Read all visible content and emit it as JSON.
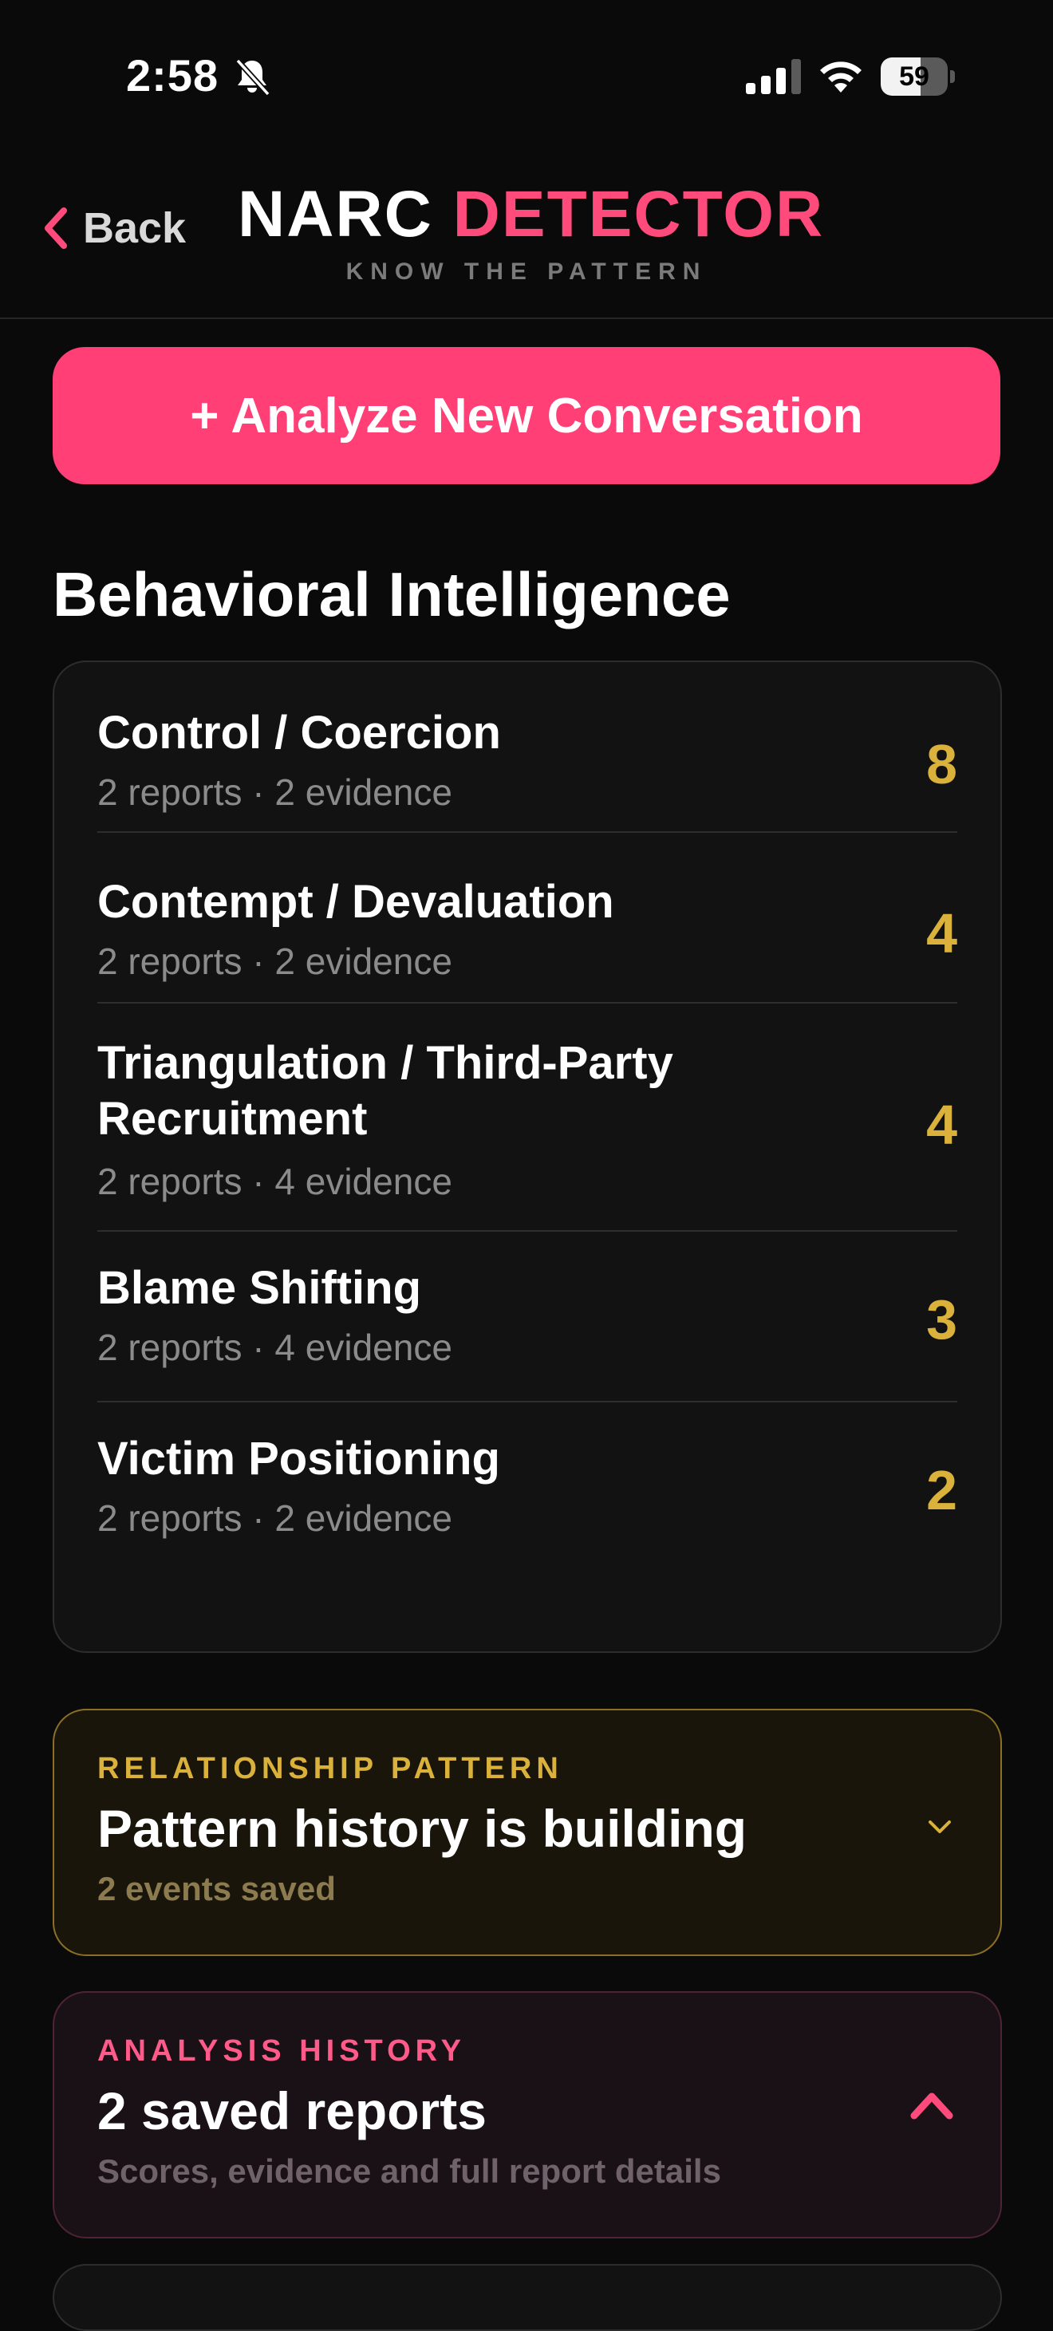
{
  "status_bar": {
    "time": "2:58",
    "battery": "59",
    "battery_level": 0.59
  },
  "nav": {
    "back_label": "Back",
    "title_part1": "NARC",
    "title_part2": "DETECTOR",
    "subtitle": "KNOW THE PATTERN"
  },
  "analyze_button": "+ Analyze New Conversation",
  "behavioral_title": "Behavioral Intelligence",
  "behaviors": [
    {
      "label": "Control / Coercion",
      "meta": "2 reports · 2 evidence",
      "score": "8"
    },
    {
      "label": "Contempt / Devaluation",
      "meta": "2 reports · 2 evidence",
      "score": "4"
    },
    {
      "label": "Triangulation / Third-Party Recruitment",
      "meta": "2 reports · 4 evidence",
      "score": "4"
    },
    {
      "label": "Blame Shifting",
      "meta": "2 reports · 4 evidence",
      "score": "3"
    },
    {
      "label": "Victim Positioning",
      "meta": "2 reports · 2 evidence",
      "score": "2"
    }
  ],
  "pattern_card": {
    "eyebrow": "RELATIONSHIP PATTERN",
    "heading": "Pattern history is building",
    "sub": "2 events saved",
    "icon": "chevron-down-icon"
  },
  "history_card": {
    "eyebrow": "ANALYSIS HISTORY",
    "heading": "2 saved reports",
    "sub": "Scores, evidence and full report details",
    "icon": "chevron-up-icon"
  },
  "colors": {
    "accent": "#ff3f76",
    "gold": "#d9b13b",
    "background": "#0a0a0a"
  }
}
